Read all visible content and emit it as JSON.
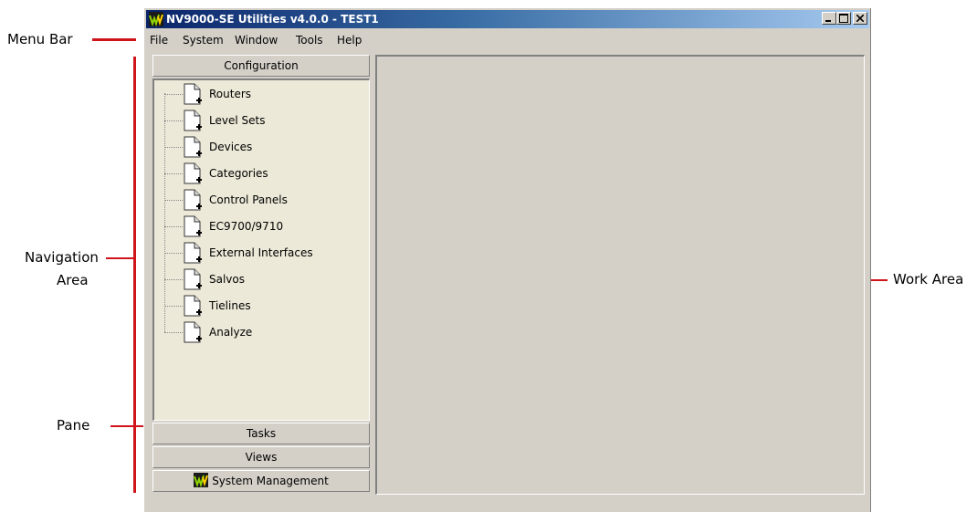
{
  "callouts": {
    "menu_bar": "Menu Bar",
    "navigation_line1": "Navigation",
    "navigation_line2": "Area",
    "pane": "Pane",
    "work_area": "Work Area"
  },
  "window": {
    "title": "NV9000-SE Utilities v4.0.0 - TEST1",
    "controls": [
      "minimize-icon",
      "maximize-icon",
      "close-icon"
    ]
  },
  "menu": [
    "File",
    "System",
    "Window",
    "Tools",
    "Help"
  ],
  "navigation": {
    "configuration_header": "Configuration",
    "tree_items": [
      "Routers",
      "Level Sets",
      "Devices",
      "Categories",
      "Control Panels",
      "EC9700/9710",
      "External Interfaces",
      "Salvos",
      "Tielines",
      "Analyze"
    ],
    "tasks_header": "Tasks",
    "views_header": "Views",
    "system_management_header": "System Management"
  },
  "colors": {
    "callout_line": "#d0141c",
    "window_face": "#d4d0c8",
    "tree_background": "#ece9d8",
    "title_gradient_start": "#0a246a",
    "title_gradient_end": "#a6caf0"
  }
}
